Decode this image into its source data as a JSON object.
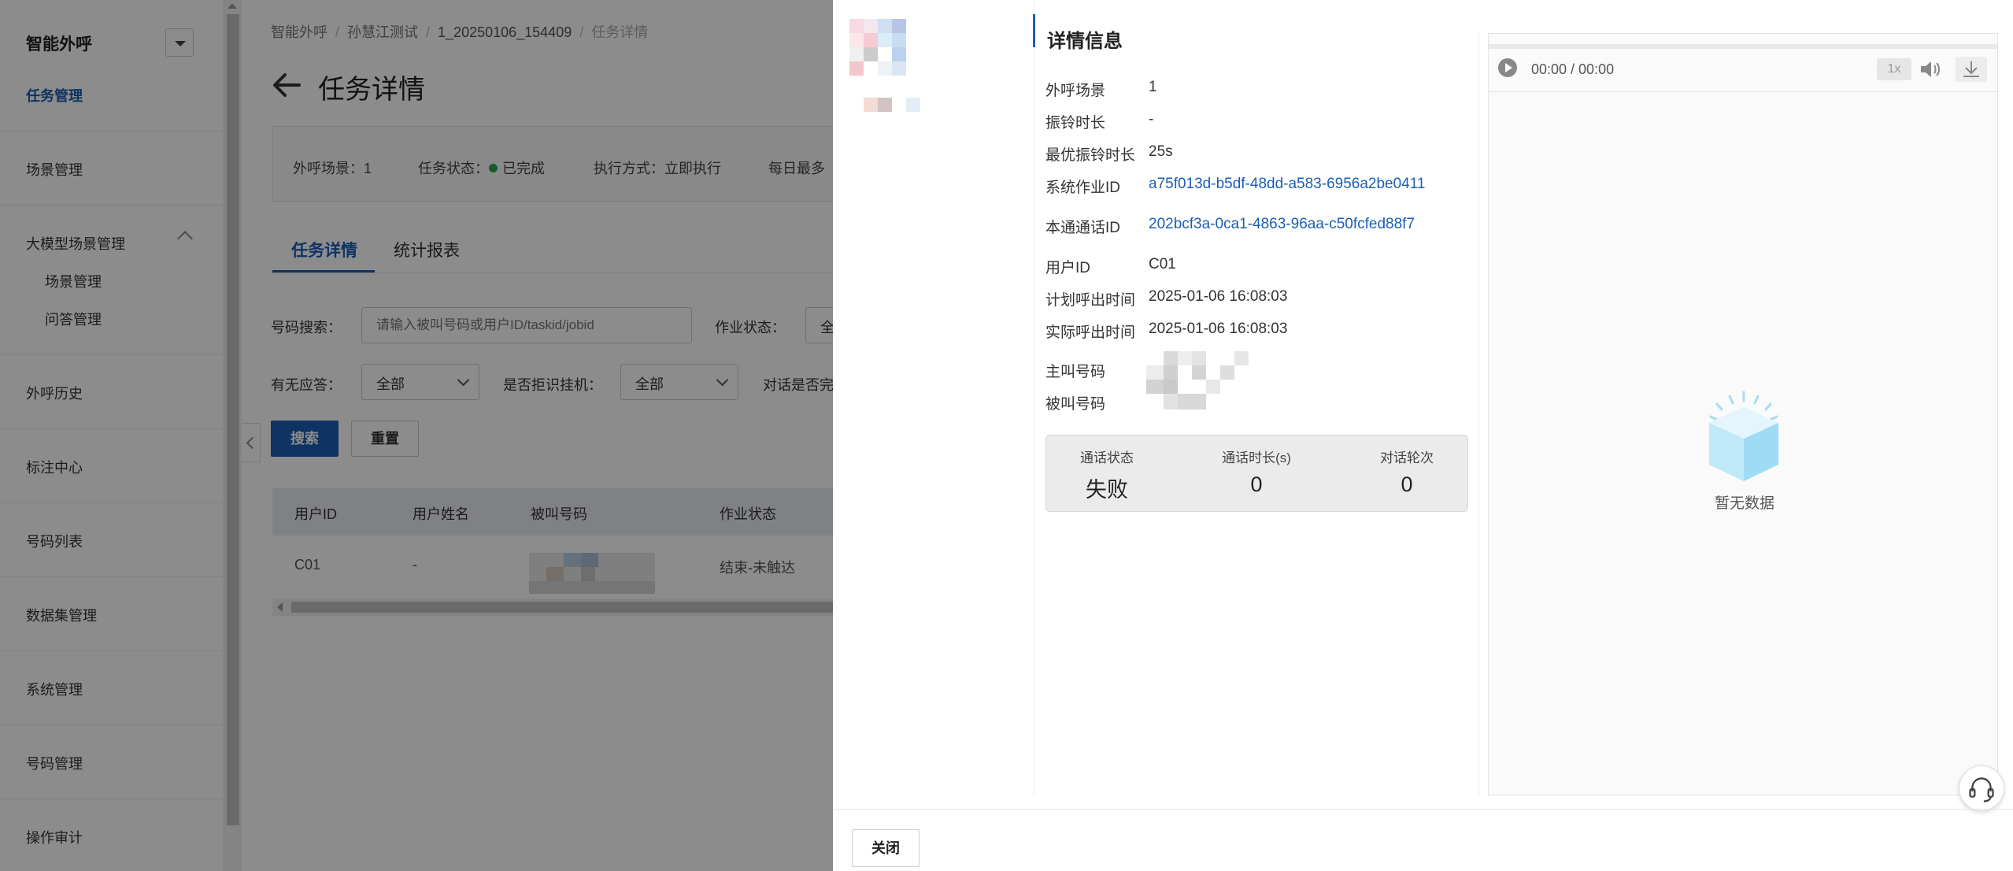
{
  "sidebar": {
    "title": "智能外呼",
    "items": [
      {
        "label": "任务管理"
      },
      {
        "label": "场景管理"
      },
      {
        "label": "大模型场景管理"
      },
      {
        "label": "场景管理"
      },
      {
        "label": "问答管理"
      },
      {
        "label": "外呼历史"
      },
      {
        "label": "标注中心"
      },
      {
        "label": "号码列表"
      },
      {
        "label": "数据集管理"
      },
      {
        "label": "系统管理"
      },
      {
        "label": "号码管理"
      },
      {
        "label": "操作审计"
      }
    ]
  },
  "breadcrumb": [
    "智能外呼",
    "孙慧江测试",
    "1_20250106_154409",
    "任务详情"
  ],
  "breadcrumb_sep": "/",
  "page_title": "任务详情",
  "info": {
    "scene": "外呼场景：1",
    "status_label": "任务状态：",
    "status_value": "已完成",
    "exec": "执行方式：立即执行",
    "daily": "每日最多"
  },
  "tabs": {
    "detail": "任务详情",
    "report": "统计报表"
  },
  "filters": {
    "search_label": "号码搜索：",
    "search_placeholder": "请输入被叫号码或用户ID/taskid/jobid",
    "job_status_label": "作业状态：",
    "job_status_value": "全",
    "answer_label": "有无应答：",
    "answer_value": "全部",
    "reject_label": "是否拒识挂机：",
    "reject_value": "全部",
    "dialog_label": "对话是否完"
  },
  "buttons": {
    "search": "搜索",
    "reset": "重置",
    "close": "关闭"
  },
  "table": {
    "headers": [
      "用户ID",
      "用户姓名",
      "被叫号码",
      "作业状态"
    ],
    "rows": [
      [
        "C01",
        "-",
        "",
        "结束-未触达"
      ]
    ]
  },
  "detail": {
    "title": "详情信息",
    "fields": [
      {
        "label": "外呼场景",
        "value": "1"
      },
      {
        "label": "振铃时长",
        "value": "-"
      },
      {
        "label": "最优振铃时长",
        "value": "25s"
      },
      {
        "label": "系统作业ID",
        "value": "a75f013d-b5df-48dd-a583-6956a2be0411"
      },
      {
        "label": "本通通话ID",
        "value": "202bcf3a-0ca1-4863-96aa-c50fcfed88f7"
      },
      {
        "label": "用户ID",
        "value": "C01"
      },
      {
        "label": "计划呼出时间",
        "value": "2025-01-06 16:08:03"
      },
      {
        "label": "实际呼出时间",
        "value": "2025-01-06 16:08:03"
      },
      {
        "label": "主叫号码",
        "value": ""
      },
      {
        "label": "被叫号码",
        "value": ""
      }
    ],
    "stats": [
      {
        "label": "通话状态",
        "value": "失败"
      },
      {
        "label": "通话时长(s)",
        "value": "0"
      },
      {
        "label": "对话轮次",
        "value": "0"
      }
    ]
  },
  "player": {
    "time": "00:00 / 00:00",
    "speed": "1x",
    "empty_text": "暂无数据"
  },
  "colors": {
    "accent": "#1a5fb4",
    "success": "#2aa745"
  },
  "icons": [
    "back-arrow-icon",
    "play-icon",
    "volume-icon",
    "download-icon",
    "empty-box-icon",
    "headset-icon",
    "chevron-down-icon",
    "chevron-up-icon"
  ]
}
